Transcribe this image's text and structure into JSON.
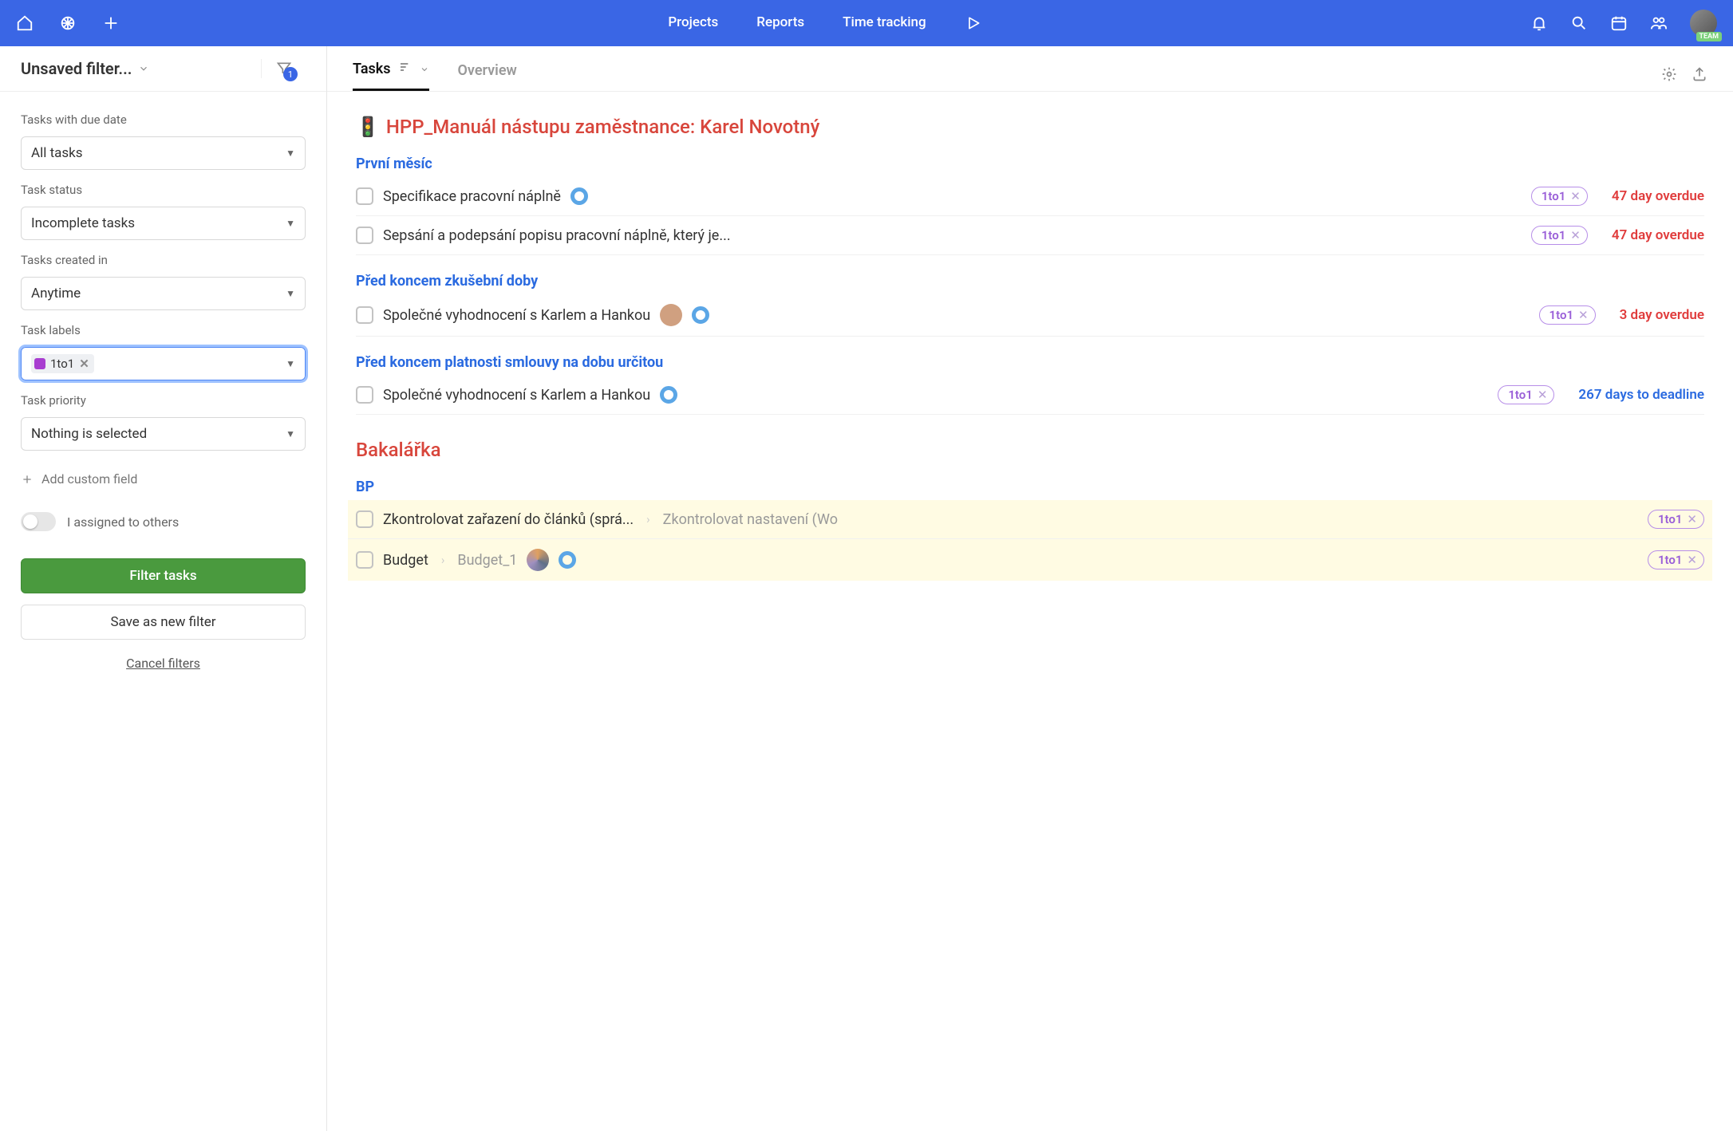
{
  "topnav": {
    "projects": "Projects",
    "reports": "Reports",
    "time_tracking": "Time tracking",
    "team_badge": "TEAM"
  },
  "sidebar": {
    "title": "Unsaved filter...",
    "funnel_count": "1",
    "fields": {
      "due_date": {
        "label": "Tasks with due date",
        "value": "All tasks"
      },
      "status": {
        "label": "Task status",
        "value": "Incomplete tasks"
      },
      "created": {
        "label": "Tasks created in",
        "value": "Anytime"
      },
      "labels": {
        "label": "Task labels",
        "chip": "1to1"
      },
      "priority": {
        "label": "Task priority",
        "value": "Nothing is selected"
      }
    },
    "add_custom_field": "Add custom field",
    "assigned_to_others": "I assigned to others",
    "filter_btn": "Filter tasks",
    "save_btn": "Save as new filter",
    "cancel": "Cancel filters"
  },
  "tabs": {
    "tasks": "Tasks",
    "overview": "Overview"
  },
  "content": {
    "project1_emoji": "🚦",
    "project1_title": "HPP_Manuál nástupu zaměstnance: Karel Novotný",
    "section1_title": "První měsíc",
    "task1": {
      "name": "Specifikace pracovní náplně",
      "label": "1to1",
      "due": "47 day overdue"
    },
    "task2": {
      "name": "Sepsání a podepsání popisu pracovní náplně, který je...",
      "label": "1to1",
      "due": "47 day overdue"
    },
    "section2_title": "Před koncem zkušební doby",
    "task3": {
      "name": "Společné vyhodnocení s Karlem a Hankou",
      "label": "1to1",
      "due": "3 day overdue"
    },
    "section3_title": "Před koncem platnosti smlouvy na dobu určitou",
    "task4": {
      "name": "Společné vyhodnocení s Karlem a Hankou",
      "label": "1to1",
      "due": "267 days to deadline"
    },
    "project2_title": "Bakalářka",
    "section4_title": "BP",
    "task5": {
      "name": "Zkontrolovat zařazení do článků (sprá...",
      "sub": "Zkontrolovat nastavení (Wo",
      "label": "1to1"
    },
    "task6": {
      "name": "Budget",
      "sub": "Budget_1",
      "label": "1to1"
    }
  }
}
